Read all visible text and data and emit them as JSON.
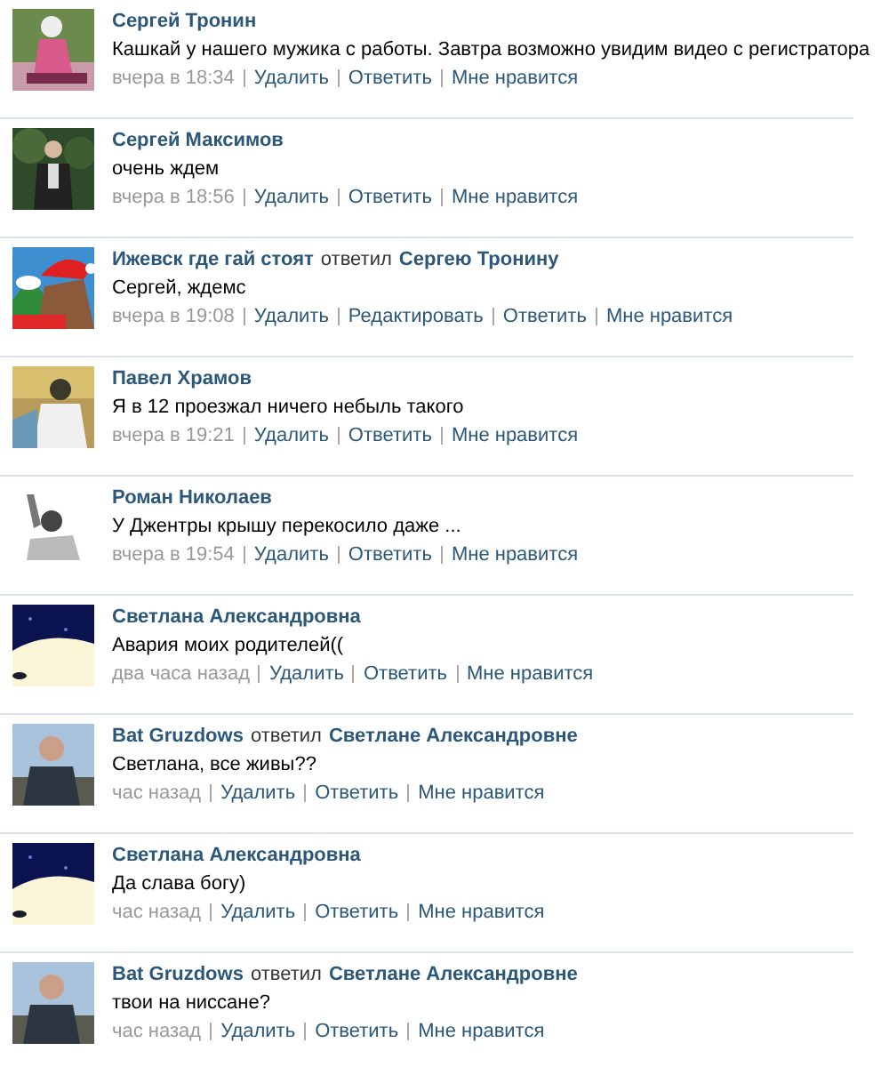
{
  "comments": [
    {
      "author": "Сергей Тронин",
      "text": "Кашкай у нашего мужика с работы. Завтра возможно увидим видео с регистратора",
      "time": "вчера в 18:34",
      "actions": [
        "Удалить",
        "Ответить",
        "Мне нравится"
      ]
    },
    {
      "author": "Сергей Максимов",
      "text": "очень ждем",
      "time": "вчера в 18:56",
      "actions": [
        "Удалить",
        "Ответить",
        "Мне нравится"
      ]
    },
    {
      "author": "Ижевск где гай стоят",
      "reply_verb": "ответил",
      "reply_to": "Сергею Тронину",
      "text": "Сергей, ждемс",
      "time": "вчера в 19:08",
      "actions": [
        "Удалить",
        "Редактировать",
        "Ответить",
        "Мне нравится"
      ]
    },
    {
      "author": "Павел Храмов",
      "text": "Я в 12 проезжал ничего небыль такого",
      "time": "вчера в 19:21",
      "actions": [
        "Удалить",
        "Ответить",
        "Мне нравится"
      ]
    },
    {
      "author": "Роман Николаев",
      "text": "У Джентры крышу перекосило даже ...",
      "time": "вчера в 19:54",
      "actions": [
        "Удалить",
        "Ответить",
        "Мне нравится"
      ]
    },
    {
      "author": "Светлана Александровна",
      "text": "Авария моих родителей((",
      "time": "два часа назад",
      "actions": [
        "Удалить",
        "Ответить",
        "Мне нравится"
      ]
    },
    {
      "author": "Bat Gruzdows",
      "reply_verb": "ответил",
      "reply_to": "Светлане Александровне",
      "text": "Светлана, все живы??",
      "time": "час назад",
      "actions": [
        "Удалить",
        "Ответить",
        "Мне нравится"
      ]
    },
    {
      "author": "Светлана Александровна",
      "text": "Да слава богу)",
      "time": "час назад",
      "actions": [
        "Удалить",
        "Ответить",
        "Мне нравится"
      ]
    },
    {
      "author": "Bat Gruzdows",
      "reply_verb": "ответил",
      "reply_to": "Светлане Александровне",
      "text": "твои на ниссане?",
      "time": "час назад",
      "actions": [
        "Удалить",
        "Ответить",
        "Мне нравится"
      ]
    }
  ]
}
